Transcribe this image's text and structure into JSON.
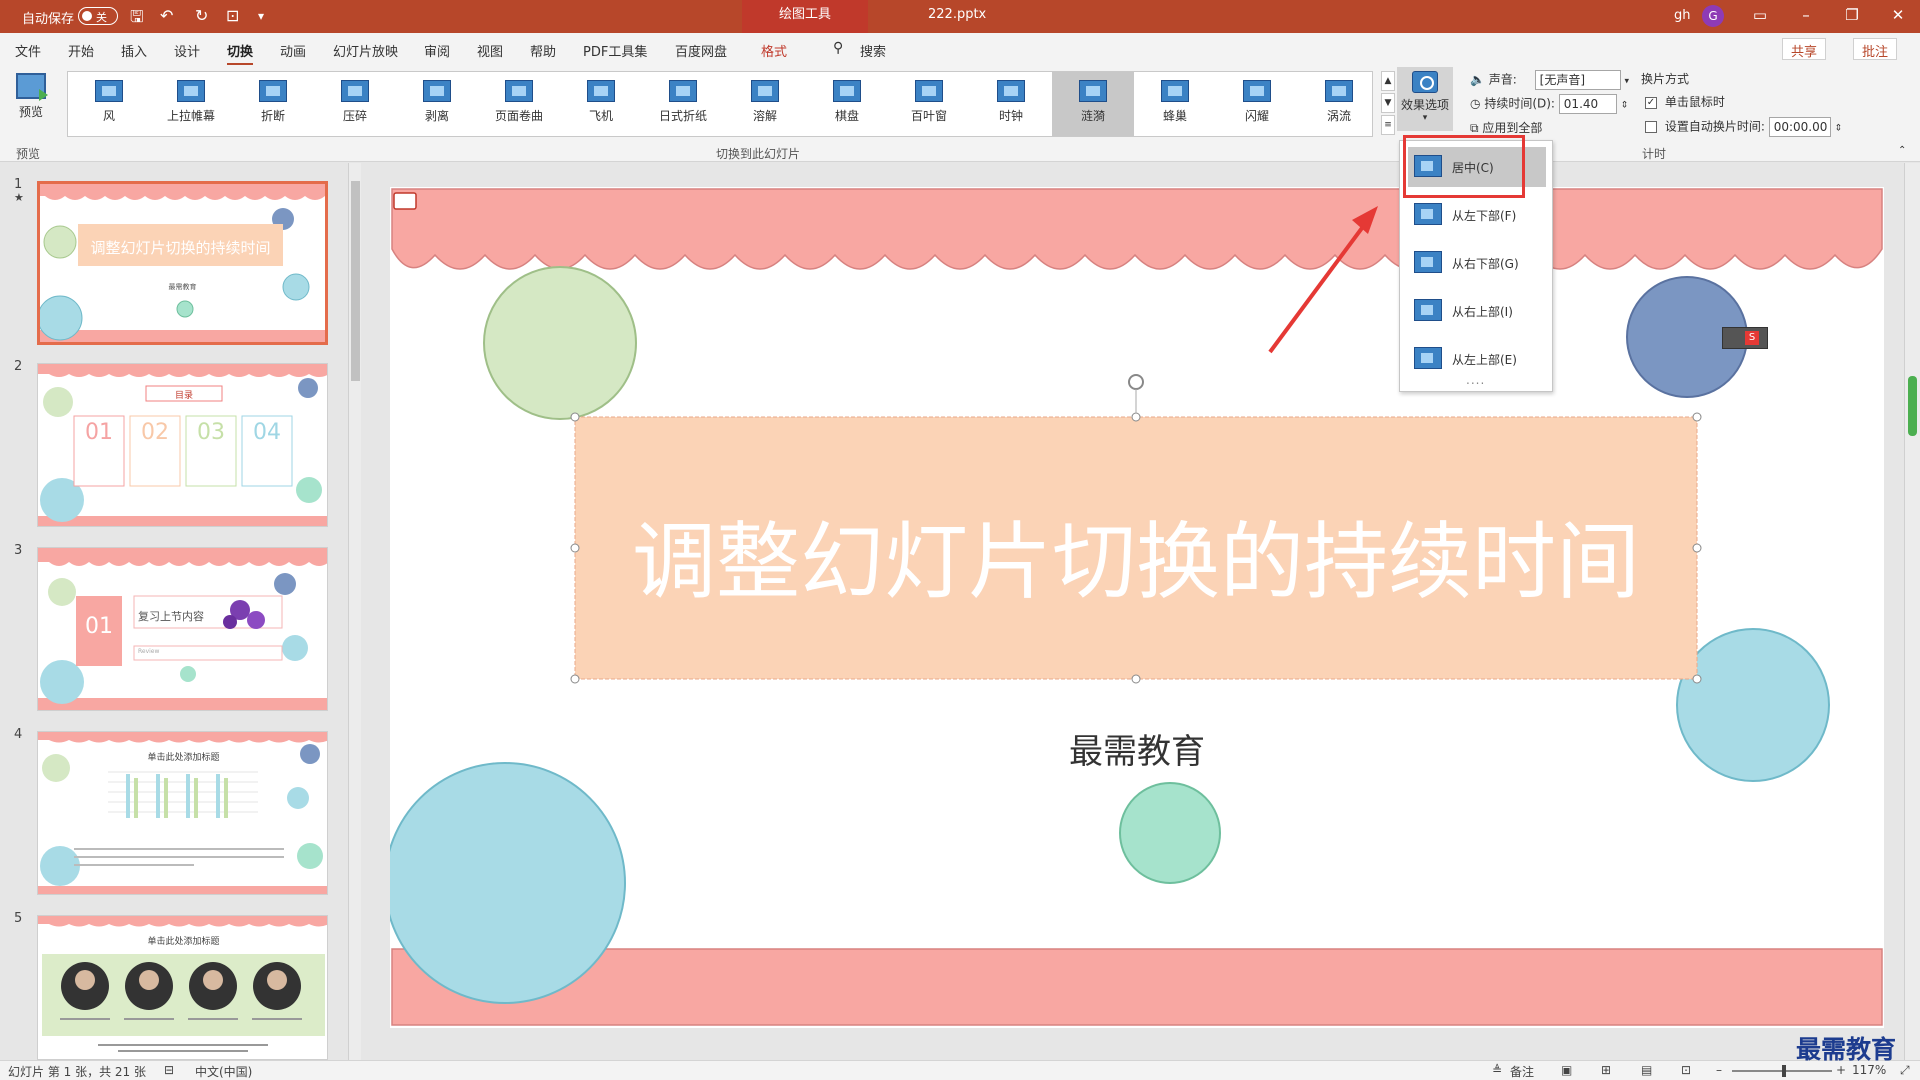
{
  "titlebar": {
    "autosave_label": "自动保存",
    "autosave_state": "关",
    "context_tab": "绘图工具",
    "doc_title": "222.pptx",
    "user_name": "gh",
    "user_initial": "G"
  },
  "tabs": [
    "文件",
    "开始",
    "插入",
    "设计",
    "切换",
    "动画",
    "幻灯片放映",
    "审阅",
    "视图",
    "帮助",
    "PDF工具集",
    "百度网盘",
    "格式"
  ],
  "active_tab": "切换",
  "search_label": "搜索",
  "share_label": "共享",
  "comment_label": "批注",
  "ribbon": {
    "preview_label": "预览",
    "preview_group": "预览",
    "transitions_group": "切换到此幻灯片",
    "transitions": [
      "风",
      "上拉帷幕",
      "折断",
      "压碎",
      "剥离",
      "页面卷曲",
      "飞机",
      "日式折纸",
      "溶解",
      "棋盘",
      "百叶窗",
      "时钟",
      "涟漪",
      "蜂巢",
      "闪耀",
      "涡流"
    ],
    "selected_transition": "涟漪",
    "effect_options_label": "效果选项",
    "sound_label": "声音:",
    "sound_value": "[无声音]",
    "duration_label": "持续时间(D):",
    "duration_value": "01.40",
    "apply_all_label": "应用到全部",
    "advance_label": "换片方式",
    "on_click_label": "单击鼠标时",
    "after_label": "设置自动换片时间:",
    "after_value": "00:00.00",
    "timing_group": "计时"
  },
  "effect_menu": [
    "居中(C)",
    "从左下部(F)",
    "从右下部(G)",
    "从右上部(I)",
    "从左上部(E)"
  ],
  "slide": {
    "title": "调整幻灯片切换的持续时间",
    "subtitle": "最需教育"
  },
  "thumbnails": {
    "slide1_title": "调整幻灯片切换的持续时间",
    "slide1_sub": "最需教育",
    "slide2_title": "目录",
    "slide2_nums": [
      "01",
      "02",
      "03",
      "04"
    ],
    "slide3_num": "01",
    "slide3_title": "复习上节内容",
    "slide3_sub": "Review",
    "slide4_title": "单击此处添加标题",
    "slide5_title": "单击此处添加标题"
  },
  "statusbar": {
    "slide_info": "幻灯片 第 1 张，共 21 张",
    "language": "中文(中国)",
    "notes_label": "备注",
    "zoom": "117%"
  },
  "watermark": "最需教育",
  "colors": {
    "accent": "#b7472a",
    "scallop": "#f8a7a2",
    "title_box": "#fbd3b6",
    "green_circle": "#d5e8c4",
    "blue_circle": "#a8dbe6",
    "navy_circle": "#7b96c2",
    "mint_circle": "#a6e3cc"
  }
}
